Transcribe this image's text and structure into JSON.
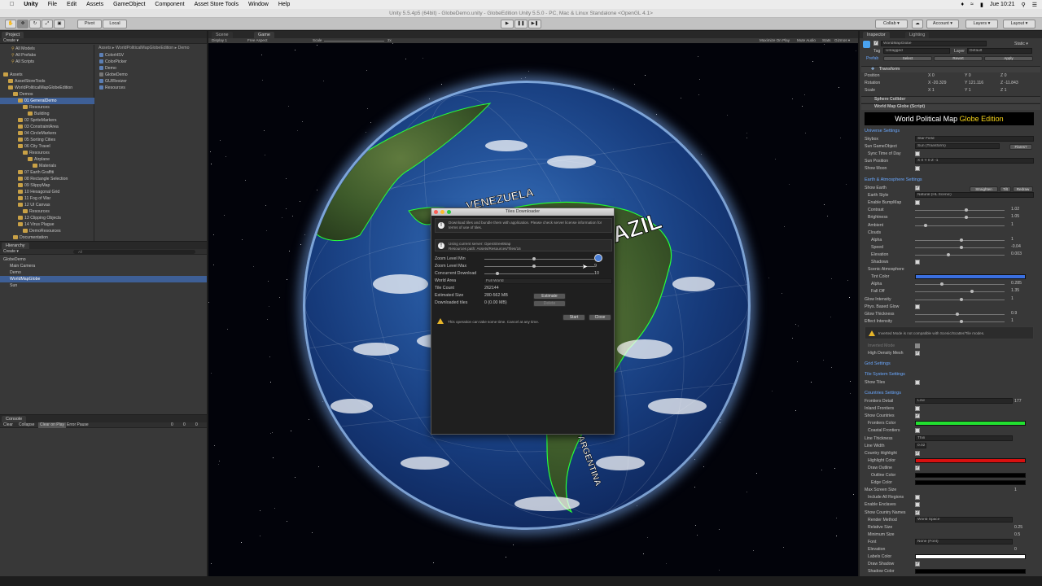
{
  "menubar": {
    "app": "Unity",
    "items": [
      "File",
      "Edit",
      "Assets",
      "GameObject",
      "Component",
      "Asset Store Tools",
      "Window",
      "Help"
    ],
    "clock": "Jue 10:21"
  },
  "window_title": "Unity 5.5.4p5 (64bit) - GlobeDemo.unity - GlobeEdition Unity 5.5.0 - PC, Mac & Linux Standalone <OpenGL 4.1>",
  "toolbar": {
    "pivot": "Pivot",
    "local": "Local",
    "collab": "Collab ▾",
    "account": "Account ▾",
    "layers": "Layers ▾",
    "layout": "Layout ▾"
  },
  "project": {
    "tab": "Project",
    "create": "Create ▾",
    "favorites": [
      "All Models",
      "All Prefabs",
      "All Scripts"
    ],
    "tree": [
      {
        "label": "Assets",
        "depth": 0,
        "sel": false
      },
      {
        "label": "AssetStoreTools",
        "depth": 1,
        "sel": false
      },
      {
        "label": "WorldPoliticalMapGlobeEdition",
        "depth": 1,
        "sel": false
      },
      {
        "label": "Demos",
        "depth": 2,
        "sel": false
      },
      {
        "label": "01 GeneralDemo",
        "depth": 3,
        "sel": true
      },
      {
        "label": "Resources",
        "depth": 4,
        "sel": false
      },
      {
        "label": "Building",
        "depth": 5,
        "sel": false
      },
      {
        "label": "02 SpriteMarkers",
        "depth": 3,
        "sel": false
      },
      {
        "label": "03 ConstraintArea",
        "depth": 3,
        "sel": false
      },
      {
        "label": "04 CircleMarkers",
        "depth": 3,
        "sel": false
      },
      {
        "label": "05 Sorting Cities",
        "depth": 3,
        "sel": false
      },
      {
        "label": "06 City Travel",
        "depth": 3,
        "sel": false
      },
      {
        "label": "Resources",
        "depth": 4,
        "sel": false
      },
      {
        "label": "Airplane",
        "depth": 5,
        "sel": false
      },
      {
        "label": "Materials",
        "depth": 6,
        "sel": false
      },
      {
        "label": "07 Earth Graffiti",
        "depth": 3,
        "sel": false
      },
      {
        "label": "08 Rectangle Selection",
        "depth": 3,
        "sel": false
      },
      {
        "label": "09 SlippyMap",
        "depth": 3,
        "sel": false
      },
      {
        "label": "10 Hexagonal Grid",
        "depth": 3,
        "sel": false
      },
      {
        "label": "11 Fog of War",
        "depth": 3,
        "sel": false
      },
      {
        "label": "12 UI Canvas",
        "depth": 3,
        "sel": false
      },
      {
        "label": "Resources",
        "depth": 4,
        "sel": false
      },
      {
        "label": "13 Clipping Objects",
        "depth": 3,
        "sel": false
      },
      {
        "label": "14 Virus Plague",
        "depth": 3,
        "sel": false
      },
      {
        "label": "DemoResources",
        "depth": 4,
        "sel": false
      },
      {
        "label": "Documentation",
        "depth": 2,
        "sel": false
      }
    ],
    "breadcrumb": "Assets ▸ WorldPoliticalMapGlobeEdition ▸ Demo",
    "files": [
      "ColorHSV",
      "ColorPicker",
      "Demo",
      "GlobeDemo",
      "GUIResizer",
      "Resources"
    ]
  },
  "hierarchy": {
    "tab": "Hierarchy",
    "create": "Create ▾",
    "search": "All",
    "items": [
      {
        "label": "GlobeDemo",
        "depth": 0,
        "sel": false
      },
      {
        "label": "Main Camera",
        "depth": 1,
        "sel": false
      },
      {
        "label": "Demo",
        "depth": 1,
        "sel": false
      },
      {
        "label": "WorldMapGlobe",
        "depth": 1,
        "sel": true
      },
      {
        "label": "Sun",
        "depth": 1,
        "sel": false
      }
    ]
  },
  "console": {
    "tab": "Console",
    "buttons": [
      "Clear",
      "Collapse",
      "Clear on Play",
      "Error Pause"
    ],
    "counts": [
      "0",
      "0",
      "0"
    ]
  },
  "scene_tabs": {
    "scene": "Scene",
    "game": "Game"
  },
  "game_bar": {
    "display": "Display 1",
    "aspect": "Free Aspect",
    "scale_label": "Scale",
    "scale_value": "2x",
    "toggles": [
      "Maximize On Play",
      "Mute Audio",
      "Stats",
      "Gizmos ▾"
    ]
  },
  "globe_labels": [
    "VENEZUELA",
    "BRAZIL",
    "ARGENTINA"
  ],
  "dialog": {
    "title": "Tiles Downloader",
    "info1": "Download tiles and bundle them with application. Please check server license information for terms of use of tiles.",
    "info2a": "Using current server: OpenStreetMap",
    "info2b": "Resources path: Assets/Resources/Tiles/16",
    "zoom_min_label": "Zoom Level Min",
    "zoom_max_label": "Zoom Level Max",
    "zoom_max_value": "9",
    "concurrent_label": "Concurrent Download",
    "concurrent_value": "10",
    "world_area_label": "World Area",
    "world_area_value": "Full World",
    "tile_count_label": "Tile Count",
    "tile_count_value": "262144",
    "estimated_label": "Estimated Size",
    "estimated_value": "280-562 MB",
    "estimate_btn": "Estimate",
    "downloaded_label": "Downloaded tiles",
    "downloaded_value": "0 (0.00 MB)",
    "delete_btn": "Delete",
    "start_btn": "Start",
    "close_btn": "Close",
    "warning": "This operation can take some time. Cancel at any time."
  },
  "inspector": {
    "tabs": [
      "Inspector",
      "Lighting"
    ],
    "object": "WorldMapGlobe",
    "static": "Static ▾",
    "tag_label": "Tag",
    "tag": "Untagged",
    "layer_label": "Layer",
    "layer": "Default",
    "prefab": "Prefab",
    "prefab_btns": [
      "Select",
      "Revert",
      "Apply"
    ],
    "transform": "Transform",
    "position": [
      "Position",
      "X 0",
      "Y 0",
      "Z 0"
    ],
    "rotation": [
      "Rotation",
      "X -20.329",
      "Y 121.116",
      "Z -11.843"
    ],
    "scale": [
      "Scale",
      "X 1",
      "Y 1",
      "Z 1"
    ],
    "comp1": "Sphere Collider",
    "comp2": "World Map Globe (Script)",
    "banner_white": "World Political Map ",
    "banner_yellow": "Globe Edition",
    "sections": {
      "universe": "Universe Settings",
      "earth": "Earth & Atmosphere Settings",
      "grid": "Grid Settings",
      "tiles": "Tile System Settings",
      "countries": "Countries Settings"
    },
    "universe_rows": [
      {
        "l": "Skybox",
        "v": "Star Field"
      },
      {
        "l": "Sun GameObject",
        "v": "Sun (Transform)"
      },
      {
        "l": "Sync Time of Day",
        "v": ""
      },
      {
        "l": "Sun Position",
        "v": "X 0     Y 0     Z -1"
      },
      {
        "l": "Show Moon",
        "v": ""
      }
    ],
    "sun_btn": "Flares?",
    "earth_rows": [
      {
        "l": "Show Earth",
        "v": ""
      },
      {
        "l": "Earth Style",
        "v": "Natural (HL Scenic)"
      },
      {
        "l": "Enable BumpMap",
        "v": ""
      },
      {
        "l": "Contrast",
        "v": "1.02"
      },
      {
        "l": "Brightness",
        "v": "1.05"
      },
      {
        "l": "Ambient",
        "v": "1"
      },
      {
        "l": "Clouds",
        "v": ""
      },
      {
        "l": "Alpha",
        "v": "1"
      },
      {
        "l": "Speed",
        "v": "-0.04"
      },
      {
        "l": "Elevation",
        "v": "0.003"
      },
      {
        "l": "Shadows",
        "v": ""
      },
      {
        "l": "Scenic Atmosphere",
        "v": ""
      },
      {
        "l": "Tint Color",
        "v": ""
      },
      {
        "l": "Alpha",
        "v": "0.285"
      },
      {
        "l": "Fall Off",
        "v": "1.35"
      },
      {
        "l": "Glow Intensity",
        "v": "1"
      },
      {
        "l": "Phys. Based Glow",
        "v": ""
      },
      {
        "l": "Glow Thickness",
        "v": "0.9"
      },
      {
        "l": "Effect Intensity",
        "v": "1"
      }
    ],
    "earth_btns": [
      "Straighten",
      "Tilt",
      "Redraw"
    ],
    "warn_text": "Inverted Mode is not compatible with Scenic/Scatter/Tile modes.",
    "inverted": "Inverted Mode",
    "high_density": "High Density Mesh",
    "show_tiles": "Show Tiles",
    "country_rows": [
      {
        "l": "Frontiers Detail",
        "v": "Low",
        "n": "177"
      },
      {
        "l": "Inland Frontiers",
        "v": "",
        "n": ""
      },
      {
        "l": "Show Countries",
        "v": "",
        "n": ""
      },
      {
        "l": "Frontiers Color",
        "v": "",
        "n": ""
      },
      {
        "l": "Coastal Frontiers",
        "v": "",
        "n": ""
      },
      {
        "l": "Line Thickness",
        "v": "Thin",
        "n": ""
      },
      {
        "l": "Line Width",
        "v": "0.02",
        "n": ""
      },
      {
        "l": "Country Highlight",
        "v": "",
        "n": ""
      },
      {
        "l": "Highlight Color",
        "v": "",
        "n": ""
      },
      {
        "l": "Draw Outline",
        "v": "",
        "n": ""
      },
      {
        "l": "Outline Color",
        "v": "",
        "n": ""
      },
      {
        "l": "Edge Color",
        "v": "",
        "n": ""
      },
      {
        "l": "Max Screen Size",
        "v": "",
        "n": "1"
      },
      {
        "l": "Include All Regions",
        "v": "",
        "n": ""
      },
      {
        "l": "Enable Enclaves",
        "v": "",
        "n": ""
      },
      {
        "l": "Show Country Names",
        "v": "",
        "n": ""
      },
      {
        "l": "Render Method",
        "v": "World Space",
        "n": ""
      },
      {
        "l": "Relative Size",
        "v": "",
        "n": "0.25"
      },
      {
        "l": "Minimum Size",
        "v": "",
        "n": "0.5"
      },
      {
        "l": "Font",
        "v": "None (Font)",
        "n": ""
      },
      {
        "l": "Elevation",
        "v": "",
        "n": "0"
      },
      {
        "l": "Labels Color",
        "v": "",
        "n": ""
      },
      {
        "l": "Draw Shadow",
        "v": "",
        "n": ""
      },
      {
        "l": "Shadow Color",
        "v": "",
        "n": ""
      }
    ]
  },
  "colors": {
    "tint": "#3a6fe0",
    "frontiers": "#22e030",
    "highlight": "#d81010",
    "outline": "#000000",
    "edge": "#000000",
    "labels": "#ffffff",
    "shadow": "#000000"
  }
}
